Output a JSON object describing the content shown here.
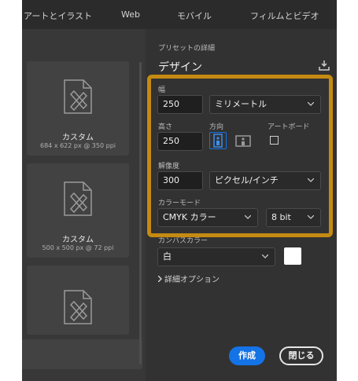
{
  "tabs": [
    "アートとイラスト",
    "Web",
    "モバイル",
    "フィルムとビデオ"
  ],
  "presets": [
    {
      "name": "カスタム",
      "dims": "684 x 622 px @ 350 ppi"
    },
    {
      "name": "カスタム",
      "dims": "500 x 500 px @ 72 ppi"
    },
    {
      "name": "",
      "dims": ""
    }
  ],
  "details": {
    "section_label": "プリセットの詳細",
    "preset_title": "デザイン",
    "width_label": "幅",
    "width_value": "250",
    "unit": "ミリメートル",
    "height_label": "高さ",
    "height_value": "250",
    "orientation_label": "方向",
    "artboard_label": "アートボード",
    "resolution_label": "解像度",
    "resolution_value": "300",
    "resolution_unit": "ピクセル/インチ",
    "color_mode_label": "カラーモード",
    "color_mode": "CMYK カラー",
    "bit_depth": "8 bit",
    "canvas_color_label": "カンバスカラー",
    "canvas_color": "白",
    "advanced_options": "詳細オプション",
    "create_button": "作成",
    "close_button": "閉じる"
  },
  "colors": {
    "accent": "#1473e6",
    "highlight": "#c48a11",
    "panel": "#323232"
  }
}
